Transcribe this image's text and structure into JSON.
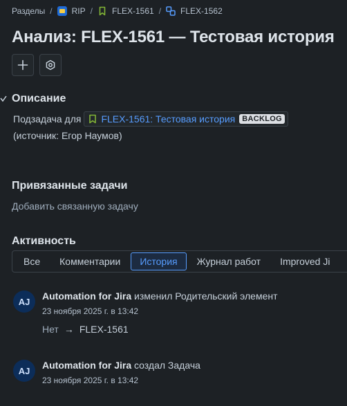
{
  "breadcrumb": {
    "root": "Разделы",
    "project": "RIP",
    "parent": "FLEX-1561",
    "current": "FLEX-1562",
    "separator": "/"
  },
  "page": {
    "title": "Анализ: FLEX-1561 — Тестовая история"
  },
  "description": {
    "heading": "Описание",
    "prefix": "Подзадача для",
    "issue_link": "FLEX-1561: Тестовая история",
    "status": "BACKLOG",
    "source": "(источник: Егор Наумов)"
  },
  "linked": {
    "heading": "Привязанные задачи",
    "add_link": "Добавить связанную задачу"
  },
  "activity": {
    "heading": "Активность",
    "tabs": [
      "Все",
      "Комментарии",
      "История",
      "Журнал работ",
      "Improved Ji"
    ],
    "active_tab": "История",
    "entries": [
      {
        "avatar": "AJ",
        "actor": "Automation for Jira",
        "action": "изменил Родительский элемент",
        "time": "23 ноября 2025 г. в 13:42",
        "from": "Нет",
        "arrow": "→",
        "to": "FLEX-1561"
      },
      {
        "avatar": "AJ",
        "actor": "Automation for Jira",
        "action": "создал Задача",
        "time": "23 ноября 2025 г. в 13:42"
      }
    ]
  },
  "icons": {
    "project": "project-icon",
    "parent": "story-icon",
    "current": "subtask-icon",
    "add": "plus-icon",
    "apps": "hexagon-settings-icon"
  },
  "colors": {
    "background": "#1d2125",
    "link": "#579dff",
    "story": "#82b536",
    "avatar": "#0c2d59"
  }
}
